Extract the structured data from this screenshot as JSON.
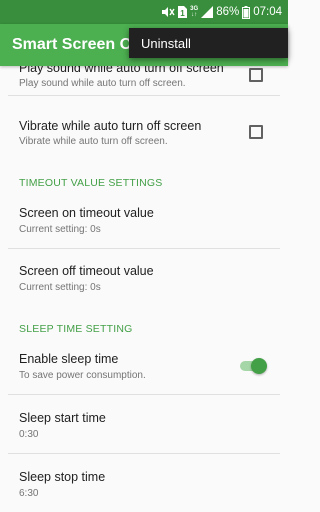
{
  "status_bar": {
    "network_top": "3G",
    "network_bottom": "↓↑",
    "battery_percent": "86%",
    "time": "07:04",
    "icons": [
      "mute-icon",
      "sim-icon",
      "signal-icon",
      "battery-icon"
    ]
  },
  "app_bar": {
    "title": "Smart Screen On Off"
  },
  "overflow_menu": {
    "items": [
      {
        "label": "Uninstall"
      }
    ]
  },
  "prefs": {
    "play_sound": {
      "title": "Play sound while auto turn off screen",
      "summary": "Play sound while auto turn off screen.",
      "checked": false
    },
    "vibrate": {
      "title": "Vibrate while auto turn off screen",
      "summary": "Vibrate while auto turn off screen.",
      "checked": false
    },
    "timeout_header": "TIMEOUT VALUE SETTINGS",
    "screen_on_timeout": {
      "title": "Screen on timeout value",
      "summary": "Current setting: 0s"
    },
    "screen_off_timeout": {
      "title": "Screen off timeout value",
      "summary": "Current setting: 0s"
    },
    "sleep_header": "SLEEP TIME SETTING",
    "enable_sleep": {
      "title": "Enable sleep time",
      "summary": "To save power consumption.",
      "enabled": true
    },
    "sleep_start": {
      "title": "Sleep start time",
      "summary": "0:30"
    },
    "sleep_stop": {
      "title": "Sleep stop time",
      "summary": "6:30"
    }
  },
  "colors": {
    "status_bar": "#388e3c",
    "app_bar": "#4caf50",
    "accent": "#43a047",
    "menu_bg": "#212121"
  }
}
